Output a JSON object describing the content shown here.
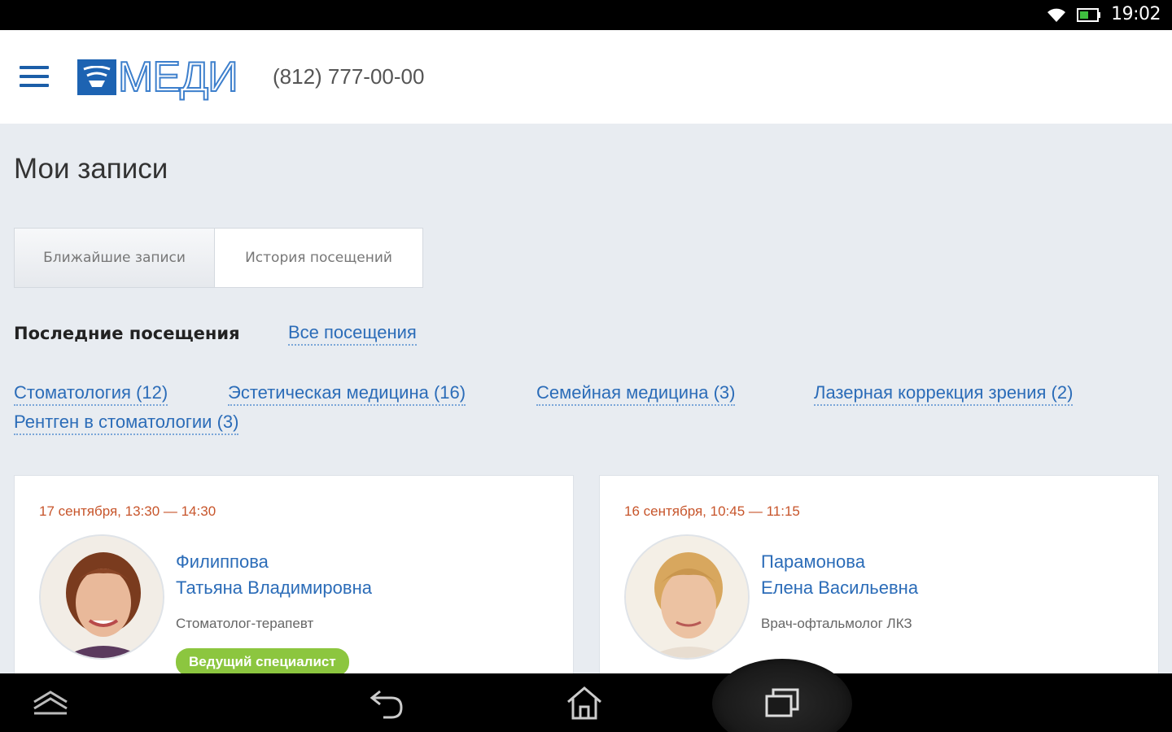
{
  "status_bar": {
    "time": "19:02",
    "icons": [
      "wifi-icon",
      "battery-icon"
    ]
  },
  "header": {
    "logo_text": "МЕДИ",
    "phone": "(812) 777-00-00",
    "menu_icon": "hamburger-menu-icon"
  },
  "page": {
    "title": "Мои записи"
  },
  "tabs": [
    {
      "label": "Ближайшие записи",
      "active": true
    },
    {
      "label": "История посещений",
      "active": false
    }
  ],
  "recent": {
    "label": "Последние посещения",
    "all_link": "Все посещения"
  },
  "categories": [
    {
      "label": "Стоматология (12)"
    },
    {
      "label": "Эстетическая медицина (16)"
    },
    {
      "label": "Семейная медицина (3)"
    },
    {
      "label": "Лазерная коррекция зрения (2)"
    },
    {
      "label": "Рентген в стоматологии (3)"
    }
  ],
  "visits": [
    {
      "time": "17 сентября, 13:30 — 14:30",
      "last_name": "Филиппова",
      "first_name": "Татьяна Владимировна",
      "specialty": "Стоматолог-терапевт",
      "badge": "Ведущий специалист"
    },
    {
      "time": "16 сентября, 10:45 — 11:15",
      "last_name": "Парамонова",
      "first_name": "Елена Васильевна",
      "specialty": "Врач-офтальмолог ЛКЗ",
      "badge": ""
    }
  ],
  "colors": {
    "brand": "#1d63b2",
    "link": "#2b6cb8",
    "time": "#c7552b",
    "badge": "#8cc63f",
    "background": "#e8ecf1"
  },
  "nav_bar": {
    "icons": [
      "up-chevron-icon",
      "back-icon",
      "home-icon",
      "recent-apps-icon"
    ]
  }
}
